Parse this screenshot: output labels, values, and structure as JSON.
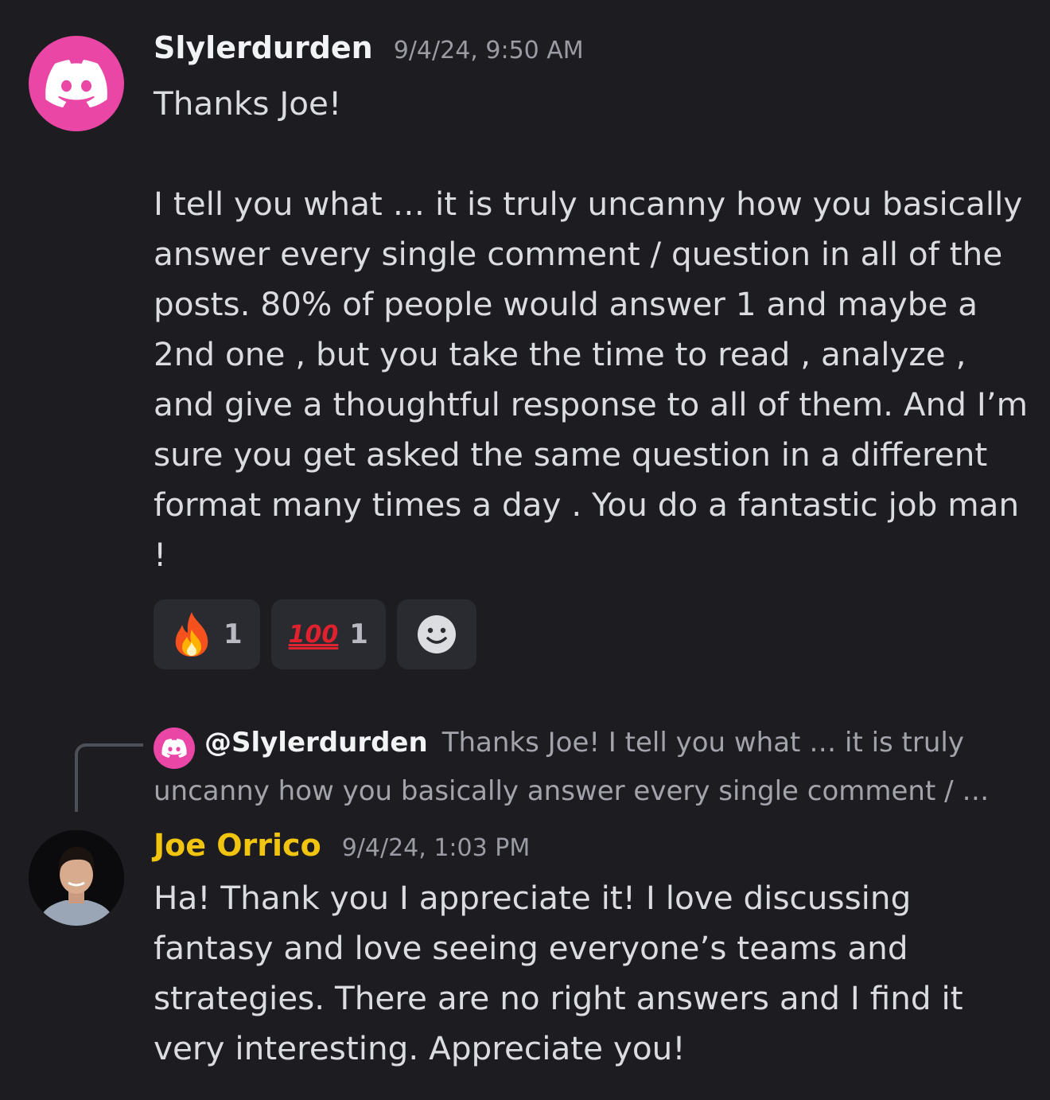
{
  "colors": {
    "background": "#1c1c21",
    "discord_pink": "#ea46a6",
    "joe_name": "#f1c40f"
  },
  "message1": {
    "avatar_icon": "discord-logo-icon",
    "username": "Slylerdurden",
    "timestamp": "9/4/24, 9:50 AM",
    "body": "Thanks Joe!\n\nI tell you what … it is truly uncanny how you basically answer every single comment / question in all of the posts. 80% of people would answer 1 and maybe a 2nd one , but you take the time to read , analyze , and give a thoughtful response to all of them. And I’m sure you get asked the same question in a different format many times a day . You do a fantastic job man !",
    "reactions": [
      {
        "icon": "fire-emoji",
        "count": "1"
      },
      {
        "icon": "hundred-points-emoji",
        "glyph": "100",
        "count": "1"
      }
    ],
    "add_reaction_icon": "smiley-face-icon"
  },
  "reply": {
    "mention": "@Slylerdurden",
    "preview": "Thanks Joe!   I tell you what … it is truly uncanny how you basically answer every single comment / …"
  },
  "message2": {
    "username": "Joe Orrico",
    "timestamp": "9/4/24, 1:03 PM",
    "body": "Ha! Thank you I appreciate it! I love discussing fantasy and love seeing everyone’s teams and strategies. There are no right answers and I find it very interesting. Appreciate you!"
  }
}
